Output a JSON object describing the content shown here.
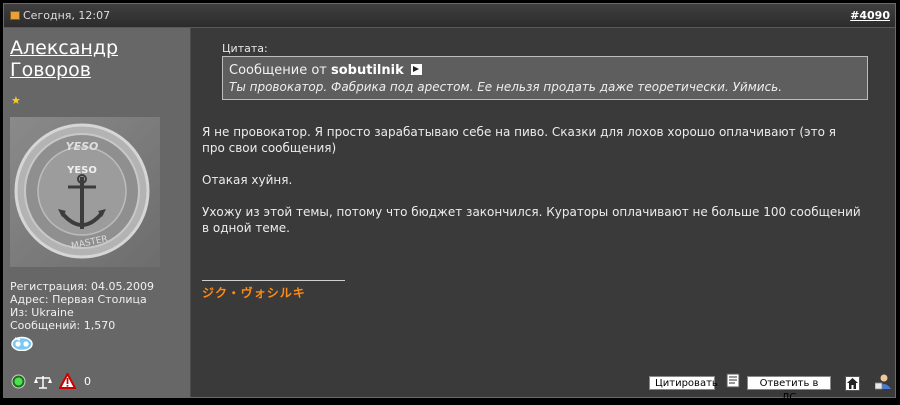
{
  "header": {
    "date": "Сегодня, 12:07",
    "post_number": "#4090"
  },
  "user": {
    "name": "Александр Говоров",
    "registration": "Регистрация: 04.05.2009",
    "address": "Адрес: Первая Столица",
    "from": "Из: Ukraine",
    "messages": "Сообщений: 1,570"
  },
  "quote": {
    "label": "Цитата:",
    "prefix": "Сообщение от",
    "author": "sobutilnik",
    "text": "Ты провокатор. Фабрика под арестом. Ее нельзя продать даже теоретически. Уймись."
  },
  "body": {
    "p1": "Я не провокатор. Я просто зарабатываю себе на пиво. Сказки для лохов хорошо оплачивают (это я про свои сообщения)",
    "p2": "Отакая хуйня.",
    "p3": "Ухожу из этой темы, потому что бюджет закончился. Кураторы оплачивают не больше 100 сообщений в одной теме."
  },
  "signature": "ジク・ヴォシルキ",
  "buttons": {
    "quote": "Цитировать",
    "reply_pm": "Ответить в ЛС"
  },
  "colors": {
    "background": "#000000",
    "post_bg": "#3a3a3a",
    "sidebar_bg": "#676767",
    "quote_bg": "#5e5e5e",
    "signature": "#ff8a14"
  }
}
